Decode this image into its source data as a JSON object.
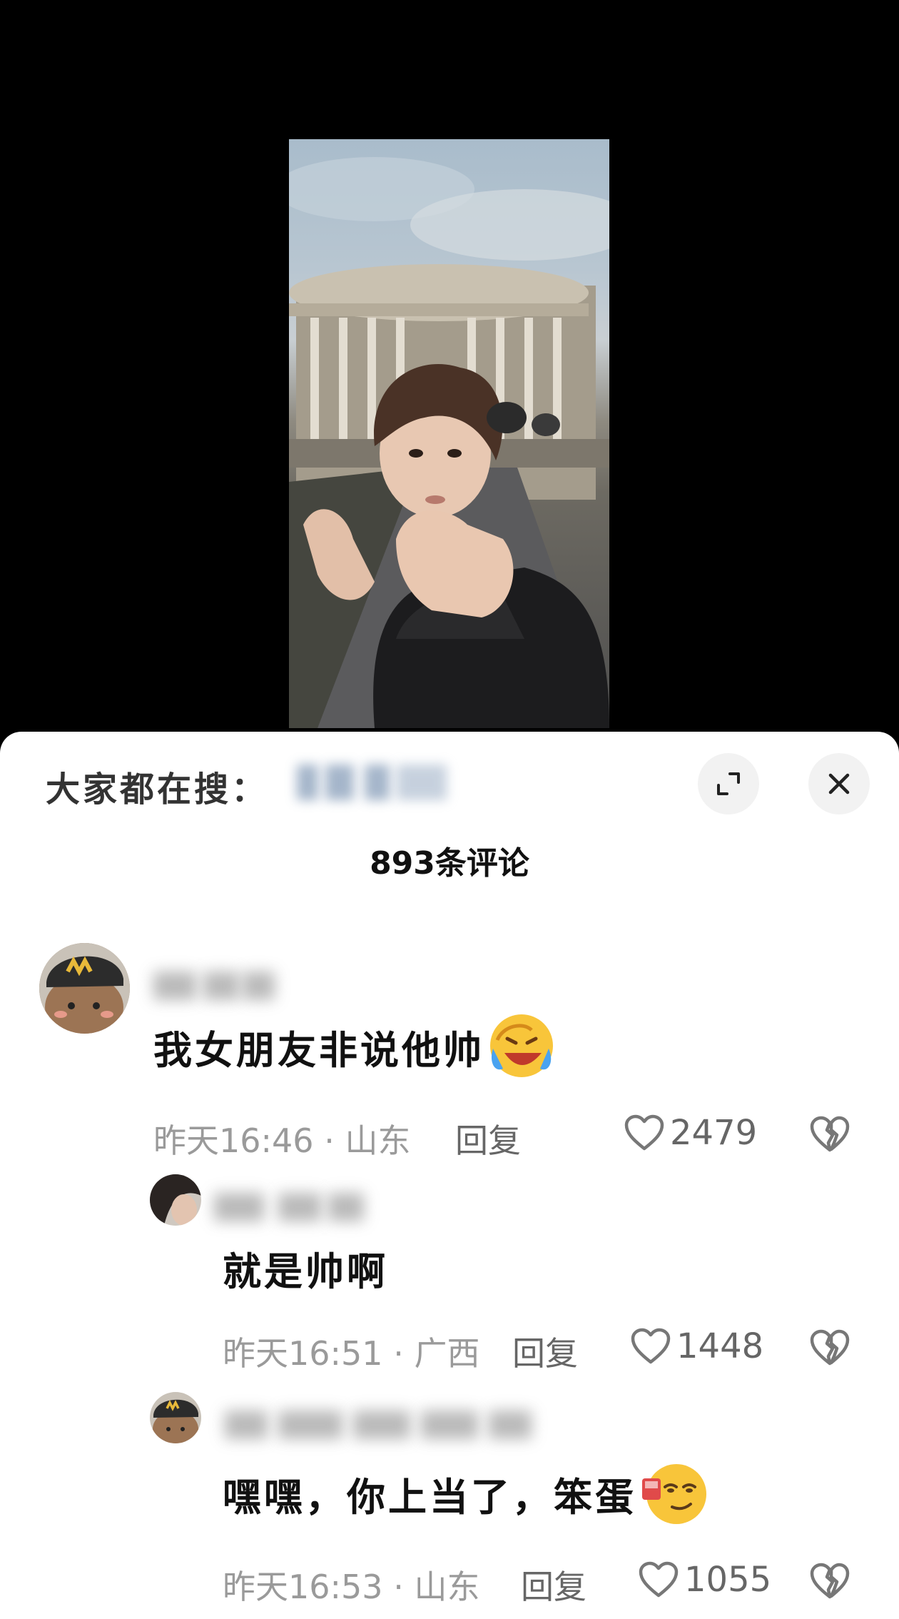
{
  "search": {
    "label": "大家都在搜："
  },
  "comments_header": {
    "count_label": "893条评论"
  },
  "comments": [
    {
      "text": "我女朋友非说他帅",
      "emoji": "crying-laughing-emoji",
      "time": "昨天16:46",
      "location": "山东",
      "reply_label": "回复",
      "likes": "2479"
    },
    {
      "text": "就是帅啊",
      "time": "昨天16:51",
      "location": "广西",
      "reply_label": "回复",
      "likes": "1448"
    },
    {
      "text": "嘿嘿，你上当了，笨蛋",
      "emoji": "smirk-drink-emoji",
      "time": "昨天16:53",
      "location": "山东",
      "reply_label": "回复",
      "likes": "1055"
    }
  ],
  "icons": {
    "expand": "expand-icon",
    "close": "close-icon",
    "like": "heart-outline-icon",
    "dislike": "broken-heart-icon"
  },
  "colors": {
    "sheet_bg": "#ffffff",
    "meta_text": "#9a9a9a",
    "button_bg": "#f2f2f2"
  }
}
